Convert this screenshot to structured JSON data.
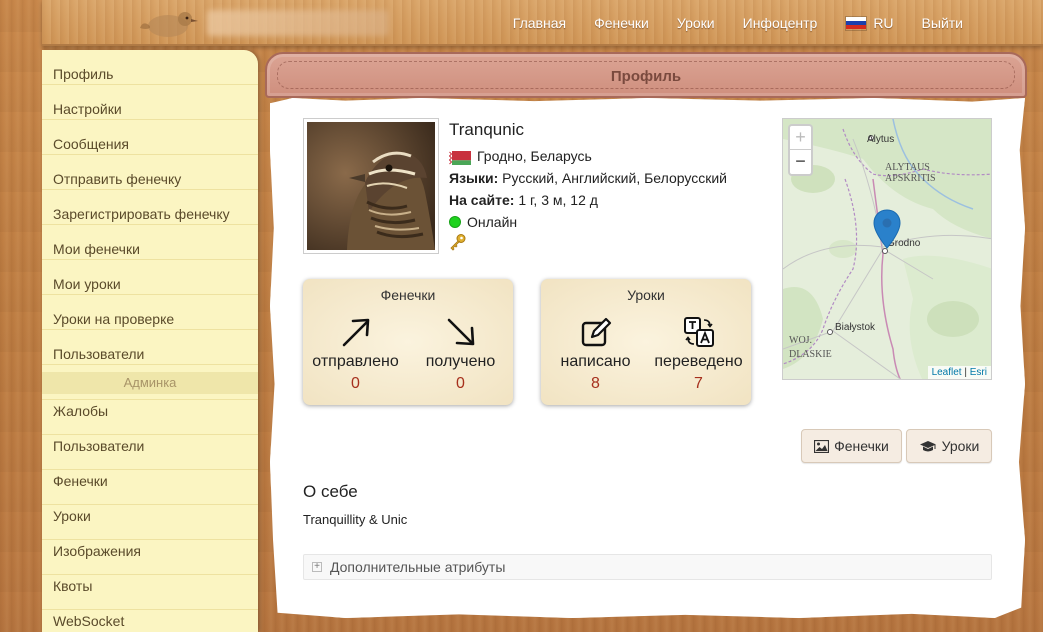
{
  "nav": {
    "home": "Главная",
    "fenechki": "Фенечки",
    "lessons": "Уроки",
    "infocenter": "Инфоцентр",
    "lang": "RU",
    "logout": "Выйти"
  },
  "sidebar": {
    "items": [
      "Профиль",
      "Настройки",
      "Сообщения",
      "Отправить фенечку",
      "Зарегистрировать фенечку",
      "Мои фенечки",
      "Мои уроки",
      "Уроки на проверке",
      "Пользователи"
    ],
    "admin_section": "Админка",
    "admin_items": [
      "Жалобы",
      "Пользователи",
      "Фенечки",
      "Уроки",
      "Изображения",
      "Квоты",
      "WebSocket"
    ]
  },
  "panel": {
    "title": "Профиль"
  },
  "profile": {
    "username": "Tranqunic",
    "location": "Гродно, Беларусь",
    "languages_label": "Языки:",
    "languages_value": "Русский, Английский, Белорусский",
    "onsite_label": "На сайте:",
    "onsite_value": "1 г, 3 м, 12 д",
    "status": "Онлайн"
  },
  "map": {
    "zoom_in": "+",
    "zoom_out": "−",
    "labels": [
      "Alytus",
      "ALYTAUS",
      "APSKRITIS",
      "Grodno",
      "Białystok",
      "WOJ.",
      "DLASKIE"
    ],
    "attrib_leaflet": "Leaflet",
    "attrib_sep": "|",
    "attrib_esri": "Esri"
  },
  "stats": {
    "fenechki": {
      "title": "Фенечки",
      "sent_label": "отправлено",
      "sent_value": "0",
      "received_label": "получено",
      "received_value": "0"
    },
    "lessons": {
      "title": "Уроки",
      "written_label": "написано",
      "written_value": "8",
      "translated_label": "переведено",
      "translated_value": "7"
    }
  },
  "buttons": {
    "fenechki": "Фенечки",
    "lessons": "Уроки"
  },
  "about": {
    "title": "О себе",
    "text": "Tranquillity & Unic"
  },
  "attributes": {
    "label": "Дополнительные атрибуты"
  },
  "colors": {
    "stat_number": "#a6301d",
    "online": "#1ed21e",
    "header_band": "#cf8f7e"
  }
}
